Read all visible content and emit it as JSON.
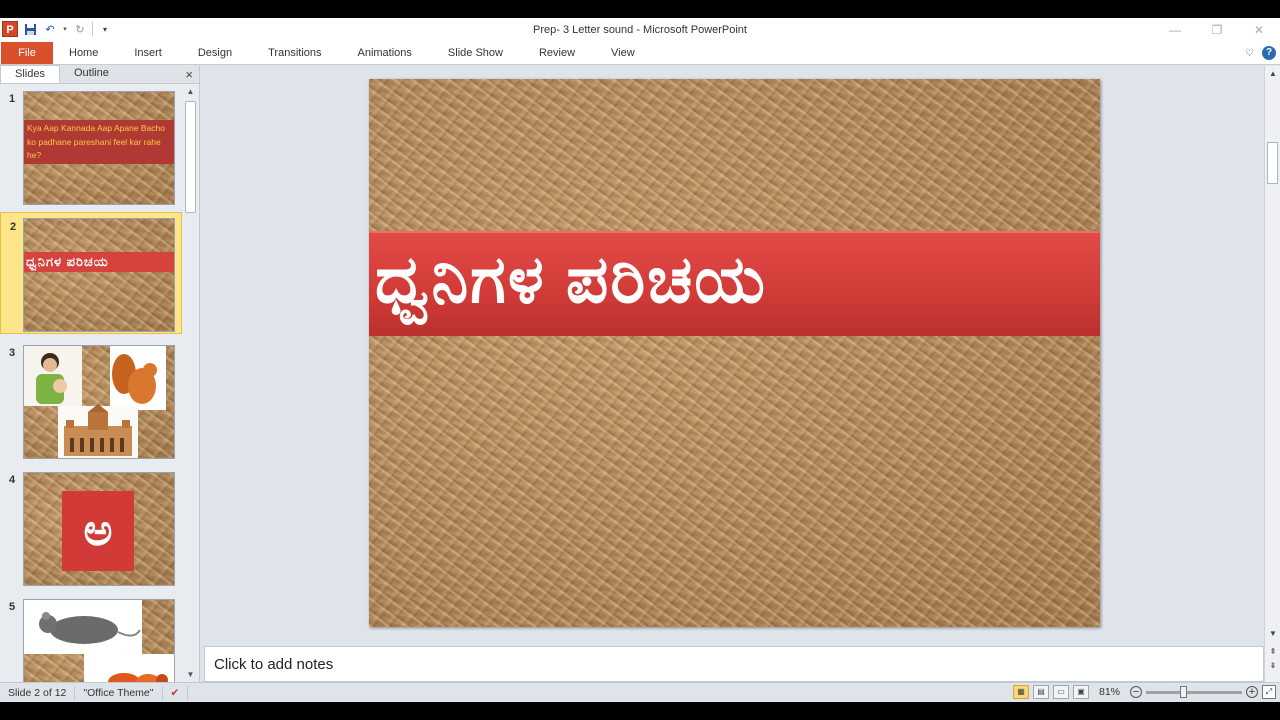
{
  "window": {
    "title": "Prep- 3 Letter sound  -  Microsoft PowerPoint",
    "controls": [
      "minimize",
      "restore",
      "close"
    ]
  },
  "quick_access": {
    "app_icon": "P",
    "items": [
      "save-icon",
      "undo-icon",
      "redo-icon",
      "customize-icon"
    ]
  },
  "ribbon": {
    "file": "File",
    "tabs": [
      "Home",
      "Insert",
      "Design",
      "Transitions",
      "Animations",
      "Slide Show",
      "Review",
      "View"
    ]
  },
  "left_pane": {
    "tabs": [
      "Slides",
      "Outline"
    ],
    "active_tab": "Slides",
    "close": "×",
    "thumbnails": [
      {
        "number": "1",
        "text": "Kya Aap Kannada Aap Apane Bacho ko padhane pareshani feel kar rahe he?"
      },
      {
        "number": "2",
        "text": "ಧ್ವನಿಗಳ  ಪರಿಚಯ",
        "selected": true
      },
      {
        "number": "3",
        "text": ""
      },
      {
        "number": "4",
        "text": "ಅ"
      },
      {
        "number": "5",
        "text": ""
      }
    ]
  },
  "slide": {
    "title": "ಧ್ವನಿಗಳ  ಪರಿಚಯ",
    "band_color": "#d6423e"
  },
  "notes": {
    "placeholder": "Click to add notes"
  },
  "status": {
    "slide_info": "Slide 2 of 12",
    "theme": "\"Office Theme\"",
    "zoom": "81%",
    "zoom_level_percent": 81
  },
  "colors": {
    "accent": "#d9512c",
    "selected_thumb": "#fde68a"
  }
}
